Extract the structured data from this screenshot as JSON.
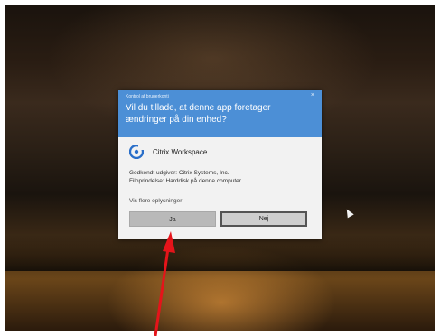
{
  "dialog": {
    "caption": "Kontrol af brugerkonti",
    "close_symbol": "×",
    "question": "Vil du tillade, at denne app foretager ændringer på din enhed?",
    "app": {
      "name": "Citrix Workspace",
      "icon": "citrix-icon"
    },
    "publisher": "Godkendt udgiver: Citrix Systems, Inc.",
    "origin": "Filoprindelse: Harddisk på denne computer",
    "more_details": "Vis flere oplysninger",
    "yes_label": "Ja",
    "no_label": "Nej"
  },
  "colors": {
    "header": "#4c8fd6",
    "dialog_bg": "#f2f2f2",
    "annotation_arrow": "#e5141a"
  }
}
